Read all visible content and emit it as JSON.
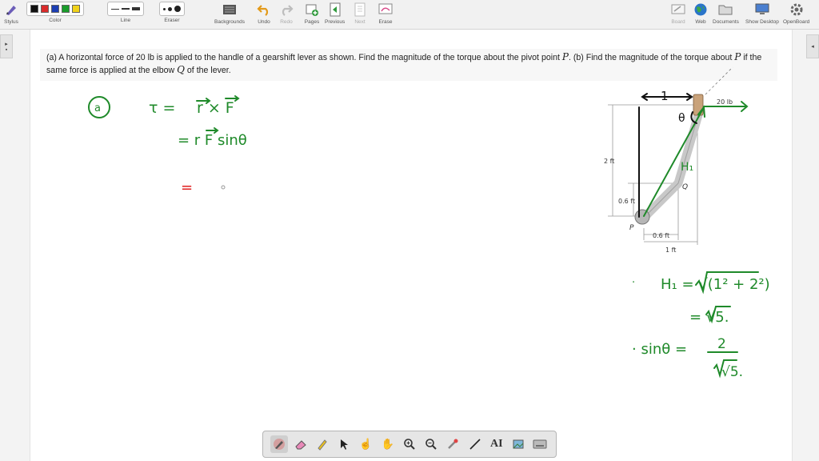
{
  "toolbar": {
    "stylus": "Stylus",
    "color": "Color",
    "line": "Line",
    "eraser": "Eraser",
    "backgrounds": "Backgrounds",
    "undo": "Undo",
    "redo": "Redo",
    "pages": "Pages",
    "previous": "Previous",
    "next": "Next",
    "erase": "Erase",
    "board": "Board",
    "web": "Web",
    "documents": "Documents",
    "show_desktop": "Show Desktop",
    "openboard": "OpenBoard",
    "colors": [
      "#111111",
      "#d92b2b",
      "#1d3fb3",
      "#1a9c2b",
      "#f0d21a"
    ]
  },
  "question": {
    "part_a_prefix": "(a) A horizontal force of 20 lb is applied to the handle of a gearshift lever as shown. Find the magnitude of the torque about the pivot point ",
    "pivot_p": "P",
    "part_b_mid": ". (b) Find the magnitude of the torque about ",
    "pivot_p2": "P",
    "part_b_mid2": " if the same force is applied at the elbow ",
    "elbow_q": "Q",
    "part_b_suffix": " of the lever."
  },
  "handwriting": {
    "part_label": "a",
    "eq1_lhs": "τ =",
    "eq1_rhs": "r × F",
    "eq2": "= r F sinθ",
    "eq3": "=",
    "h1_eq": "H₁ = √(1² + 2²)",
    "h1_val": "= √5.",
    "sin_lhs": "· sinθ =",
    "sin_num": "2",
    "sin_den": "√5.",
    "dim_top": "1",
    "theta": "θ",
    "h1_label": "H₁",
    "ink_color": "#1f8a2a",
    "red_color": "#e02020"
  },
  "figure": {
    "force_label": "20 lb",
    "height_2ft": "2 ft",
    "height_06ft": "0.6 ft",
    "width_06ft": "0.6 ft",
    "width_1ft": "1 ft",
    "label_p": "P",
    "label_q": "Q"
  }
}
